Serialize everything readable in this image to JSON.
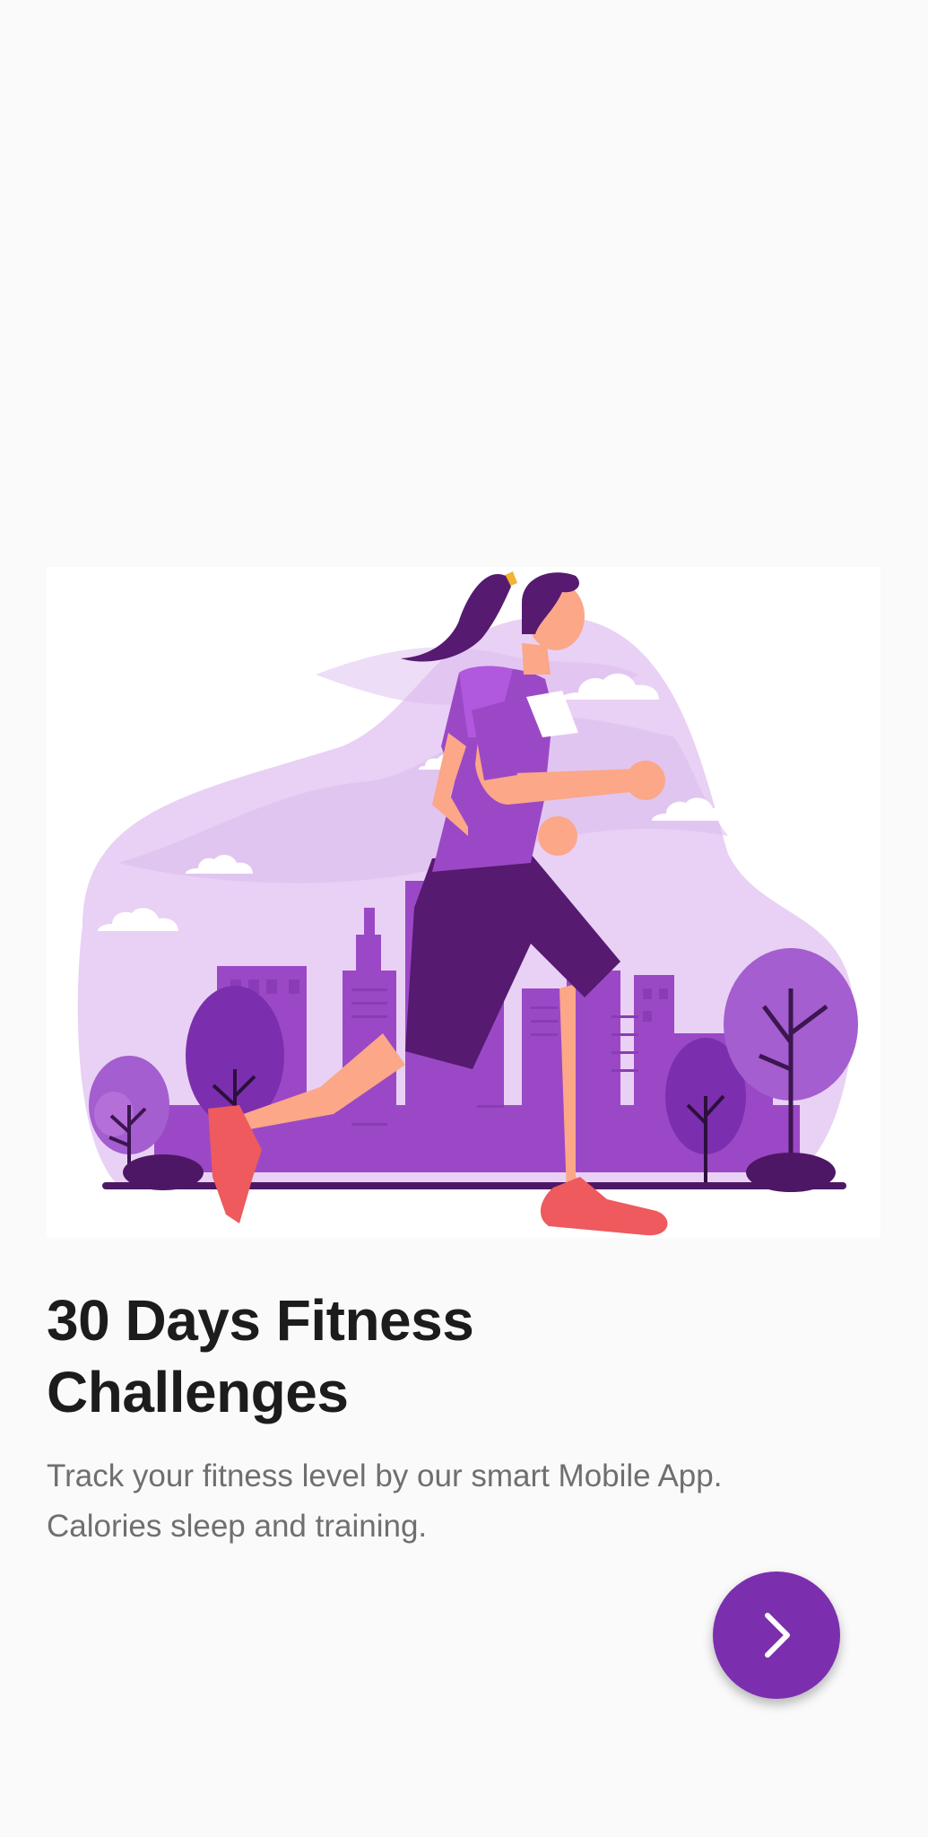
{
  "onboarding": {
    "title_line1": "30 Days Fitness",
    "title_line2": "Challenges",
    "description_line1": "Track your fitness level by our smart Mobile App.",
    "description_line2": "Calories sleep and training.",
    "illustration_icon": "woman-running-icon",
    "next_icon": "chevron-right-icon"
  },
  "colors": {
    "background": "#fafafa",
    "accent": "#7b2fae",
    "title": "#1c1c1c",
    "description": "#6f6f6f"
  }
}
